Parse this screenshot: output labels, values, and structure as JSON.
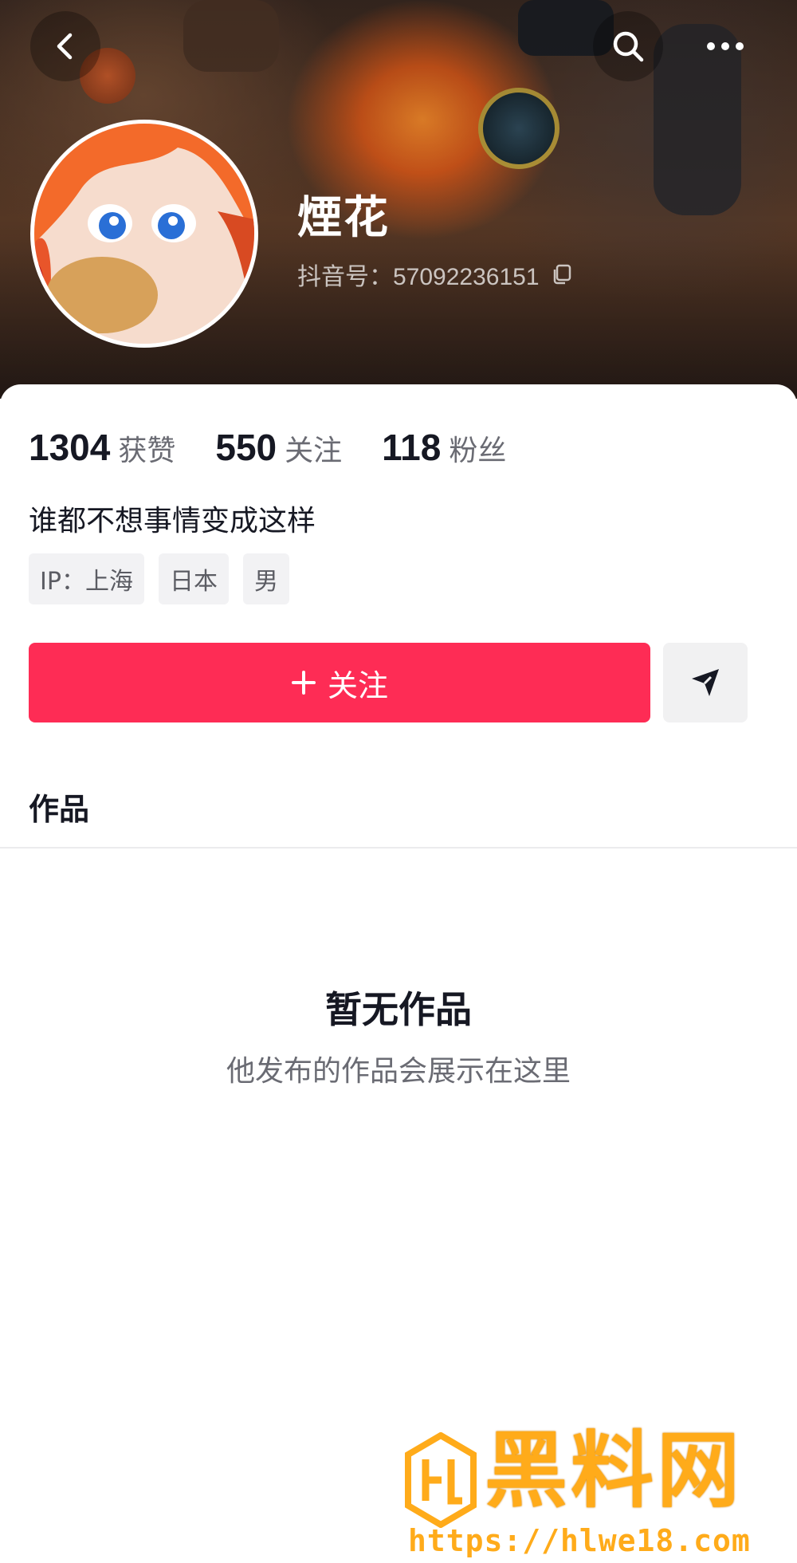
{
  "header": {
    "nickname": "煙花",
    "uid_label": "抖音号：",
    "uid_value": "57092236151",
    "icons": [
      "back-icon",
      "search-icon",
      "more-icon",
      "copy-icon"
    ]
  },
  "stats": [
    {
      "value": "1304",
      "label": "获赞"
    },
    {
      "value": "550",
      "label": "关注"
    },
    {
      "value": "118",
      "label": "粉丝"
    }
  ],
  "bio": "谁都不想事情变成这样",
  "tags": [
    "IP：上海",
    "日本",
    "男"
  ],
  "actions": {
    "follow_label": "关注",
    "follow_color": "#fe2c55",
    "share_icon": "send-icon"
  },
  "tabs": {
    "works_label": "作品"
  },
  "empty_state": {
    "title": "暂无作品",
    "subtitle": "他发布的作品会展示在这里"
  },
  "watermark": {
    "brand": "黑料网",
    "url": "https://hlwe18.com",
    "color": "#ffab1a"
  }
}
